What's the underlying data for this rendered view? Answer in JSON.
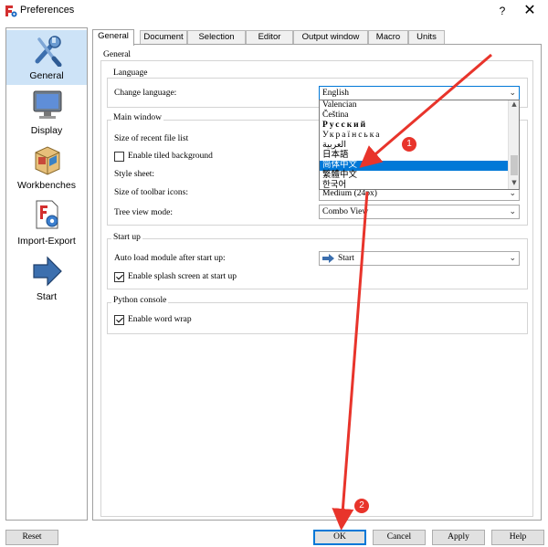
{
  "window": {
    "title": "Preferences",
    "help_label": "?",
    "close_label": "✕"
  },
  "sidebar": {
    "items": [
      {
        "label": "General",
        "icon": "wrench-screwdriver-icon",
        "active": true
      },
      {
        "label": "Display",
        "icon": "monitor-icon",
        "active": false
      },
      {
        "label": "Workbenches",
        "icon": "package-box-icon",
        "active": false
      },
      {
        "label": "Import-Export",
        "icon": "document-gear-icon",
        "active": false
      },
      {
        "label": "Start",
        "icon": "right-arrow-icon",
        "active": false
      }
    ]
  },
  "tabs": [
    {
      "label": "General",
      "active": true
    },
    {
      "label": "Document",
      "active": false
    },
    {
      "label": "Selection",
      "active": false
    },
    {
      "label": "Editor",
      "active": false
    },
    {
      "label": "Output window",
      "active": false
    },
    {
      "label": "Macro",
      "active": false
    },
    {
      "label": "Units",
      "active": false
    }
  ],
  "general": {
    "group_label": "General",
    "language": {
      "group_label": "Language",
      "change_label": "Change language:",
      "current_value": "English",
      "options": [
        {
          "label": "Valencian",
          "selected": false
        },
        {
          "label": "Čeština",
          "selected": false
        },
        {
          "label": "Русский",
          "selected": false
        },
        {
          "label": "Українська",
          "selected": false
        },
        {
          "label": "العربية",
          "selected": false
        },
        {
          "label": "日本語",
          "selected": false
        },
        {
          "label": "简体中文",
          "selected": true
        },
        {
          "label": "繁體中文",
          "selected": false
        },
        {
          "label": "한국어",
          "selected": false
        }
      ]
    },
    "main_window": {
      "group_label": "Main window",
      "recent_files_label": "Size of recent file list",
      "tiled_background_label": "Enable tiled background",
      "tiled_background_checked": false,
      "style_sheet_label": "Style sheet:",
      "toolbar_icons_label": "Size of toolbar icons:",
      "toolbar_icons_value": "Medium (24px)",
      "tree_view_label": "Tree view mode:",
      "tree_view_value": "Combo View"
    },
    "start_up": {
      "group_label": "Start up",
      "auto_load_label": "Auto load module after start up:",
      "auto_load_value": "Start",
      "splash_label": "Enable splash screen at start up",
      "splash_checked": true
    },
    "python_console": {
      "group_label": "Python console",
      "word_wrap_label": "Enable word wrap",
      "word_wrap_checked": true
    }
  },
  "buttons": {
    "reset": "Reset",
    "ok": "OK",
    "cancel": "Cancel",
    "apply": "Apply",
    "help": "Help"
  },
  "annotations": [
    {
      "label": "1"
    },
    {
      "label": "2"
    }
  ],
  "colors": {
    "accent": "#0078d7",
    "annotation": "#e8342b",
    "sidebar_active": "#cde3f7"
  }
}
